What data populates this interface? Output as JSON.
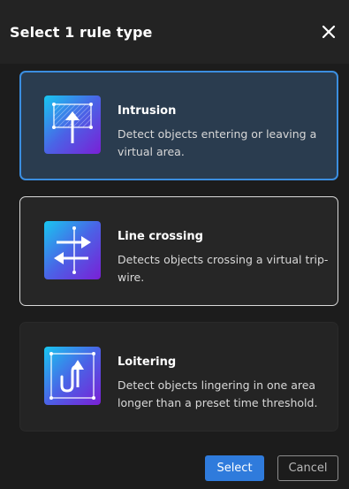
{
  "dialog": {
    "title": "Select 1 rule type",
    "close_icon": "close-icon"
  },
  "rules": [
    {
      "name": "Intrusion",
      "description": "Detect objects entering or leaving a virtual area.",
      "icon": "intrusion-icon",
      "state": "selected"
    },
    {
      "name": "Line crossing",
      "description": "Detects objects crossing a virtual trip-wire.",
      "icon": "line-crossing-icon",
      "state": "hover"
    },
    {
      "name": "Loitering",
      "description": "Detect objects lingering in one area longer than a preset time threshold.",
      "icon": "loitering-icon",
      "state": "default"
    }
  ],
  "footer": {
    "select_label": "Select",
    "cancel_label": "Cancel"
  },
  "colors": {
    "accent": "#2f7bdc",
    "selected_border": "#3b8ee0",
    "selected_bg": "#2a3c4f",
    "icon_gradient_start": "#18c7f0",
    "icon_gradient_end": "#7a1fd6"
  }
}
